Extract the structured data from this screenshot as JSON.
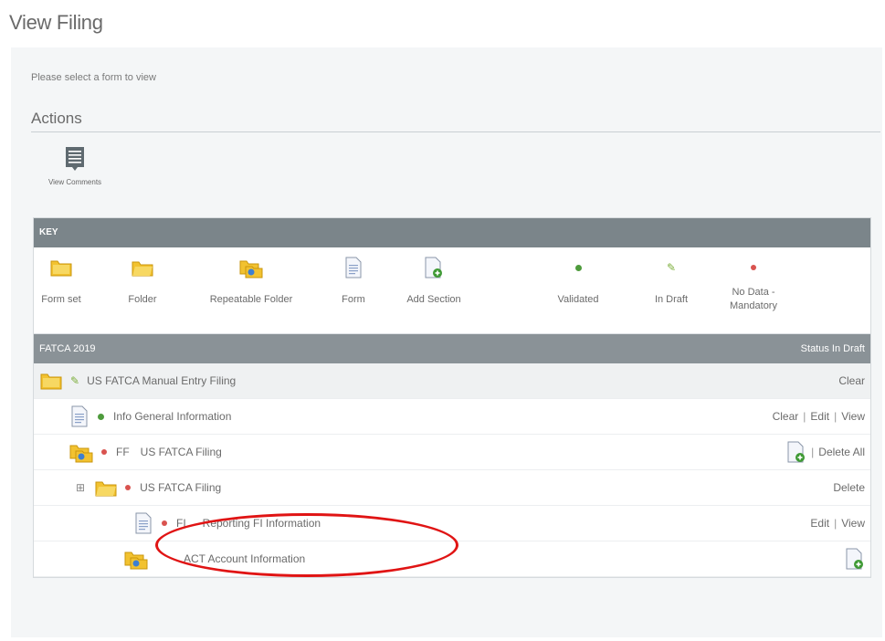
{
  "page": {
    "title": "View Filing"
  },
  "instruction": "Please select a form to view",
  "actions": {
    "heading": "Actions",
    "view_comments": "View Comments"
  },
  "key": {
    "header": "KEY",
    "items": [
      {
        "icon": "form-set-icon",
        "label": "Form set"
      },
      {
        "icon": "folder-icon",
        "label": "Folder"
      },
      {
        "icon": "repeatable-folder-icon",
        "label": "Repeatable Folder"
      },
      {
        "icon": "form-icon",
        "label": "Form"
      },
      {
        "icon": "add-section-icon",
        "label": "Add Section"
      },
      {
        "icon": "validated-icon",
        "label": "Validated"
      },
      {
        "icon": "in-draft-icon",
        "label": "In Draft"
      },
      {
        "icon": "no-data-mandatory-icon",
        "label": "No Data - Mandatory"
      }
    ]
  },
  "filing": {
    "title": "FATCA 2019",
    "status_label": "Status",
    "status_value": "In Draft"
  },
  "rows": [
    {
      "name": "US FATCA Manual Entry Filing",
      "actions": [
        "Clear"
      ]
    },
    {
      "name": "Info General Information",
      "actions": [
        "Clear",
        "Edit",
        "View"
      ]
    },
    {
      "code": "FF",
      "name": "US FATCA Filing",
      "actions": [
        "Delete All"
      ]
    },
    {
      "name": "US FATCA Filing",
      "actions": [
        "Delete"
      ]
    },
    {
      "code": "FI",
      "name": "Reporting FI Information",
      "actions": [
        "Edit",
        "View"
      ]
    },
    {
      "name": "ACT Account Information",
      "actions": []
    }
  ],
  "colors": {
    "key_header": "#7b858a",
    "filing_header": "#8a9297",
    "validated": "#4e9b3c",
    "in_draft": "#7cae3b",
    "mandatory": "#d9534f",
    "annotation": "#e01414"
  }
}
